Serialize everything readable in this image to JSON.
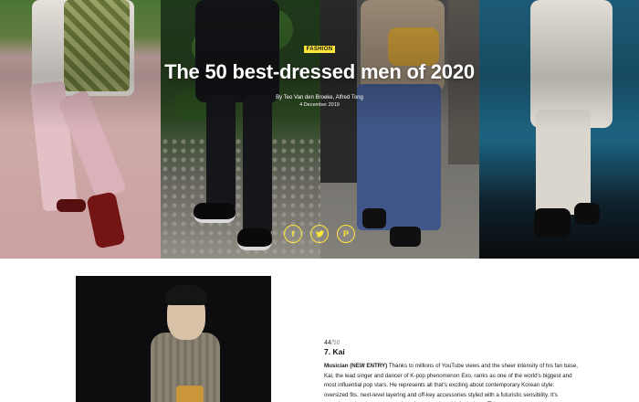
{
  "hero": {
    "category": "FASHION",
    "title": "The 50 best-dressed men of 2020",
    "byline": "By Teo Van den Broeke, Alfred Tong",
    "date": "4 December 2019"
  },
  "share": [
    {
      "network": "facebook",
      "glyph": "f"
    },
    {
      "network": "twitter",
      "glyph": "🐦"
    },
    {
      "network": "pinterest",
      "glyph": "P"
    }
  ],
  "entry": {
    "rank": "44",
    "rank_total": "/50",
    "name": "7. Kai",
    "role": "Musician (NEW ENTRY)",
    "description": "Thanks to millions of YouTube views and the sheer intensity of his fan base, Kai, the lead singer and dancer of K-pop phenomenon Exo, ranks as one of the world's biggest and most influential pop stars. He represents all that's exciting about contemporary Korean style: oversized fits, next-level layering and off-key accessories styled with a futuristic sensibility. It's experimental and courageous, but elegant and sophisticated too. This summer,"
  },
  "colors": {
    "accent": "#ffe63b"
  }
}
